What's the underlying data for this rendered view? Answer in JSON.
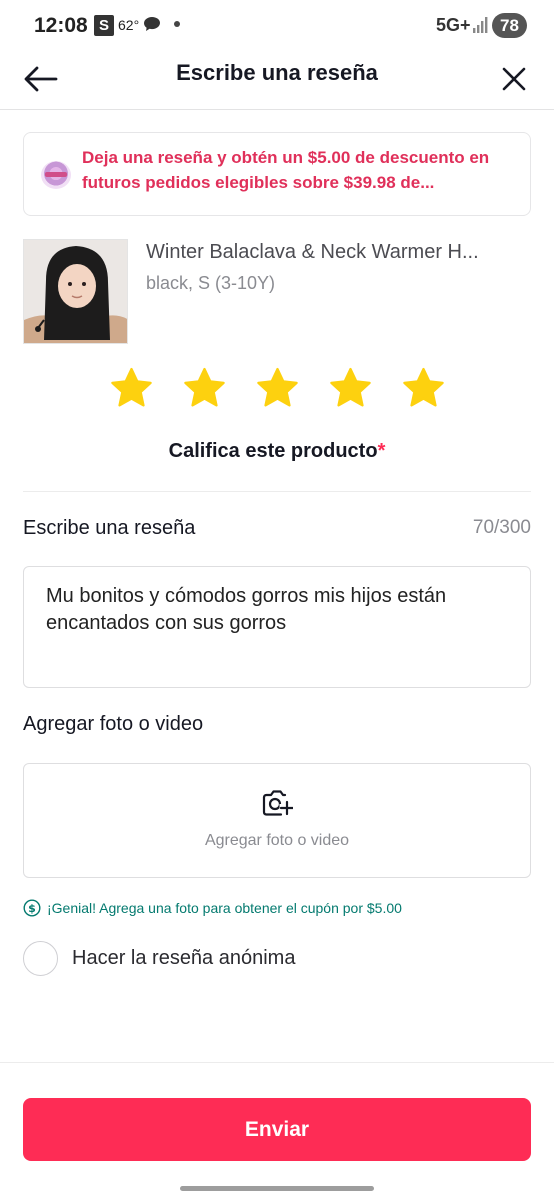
{
  "status_bar": {
    "time": "12:08",
    "s_badge": "S",
    "temperature": "62°",
    "network": "5G+",
    "battery": "78"
  },
  "header": {
    "title": "Escribe una reseña",
    "back_icon": "arrow-left-icon",
    "close_icon": "close-icon"
  },
  "promo": {
    "text": "Deja una reseña y obtén un $5.00 de descuento en futuros pedidos elegibles sobre $39.98 de..."
  },
  "product": {
    "name": "Winter Balaclava & Neck Warmer H...",
    "variant": "black, S (3-10Y)"
  },
  "rating": {
    "value": 5,
    "max": 5,
    "label": "Califica este producto",
    "required_mark": "*",
    "star_color": "#fdd10f"
  },
  "review": {
    "title": "Escribe una reseña",
    "count": "70/300",
    "text": "Mu bonitos y cómodos gorros mis hijos están encantados con sus gorros"
  },
  "media": {
    "title": "Agregar foto o video",
    "button_label": "Agregar foto o video",
    "icon": "camera-add-icon"
  },
  "hint": {
    "text": "¡Genial! Agrega una foto para obtener el cupón por $5.00",
    "icon": "dollar-circle-icon",
    "color": "#047a6f"
  },
  "anonymous": {
    "label": "Hacer la reseña anónima",
    "checked": false
  },
  "submit": {
    "label": "Enviar",
    "color": "#fe2c55"
  }
}
